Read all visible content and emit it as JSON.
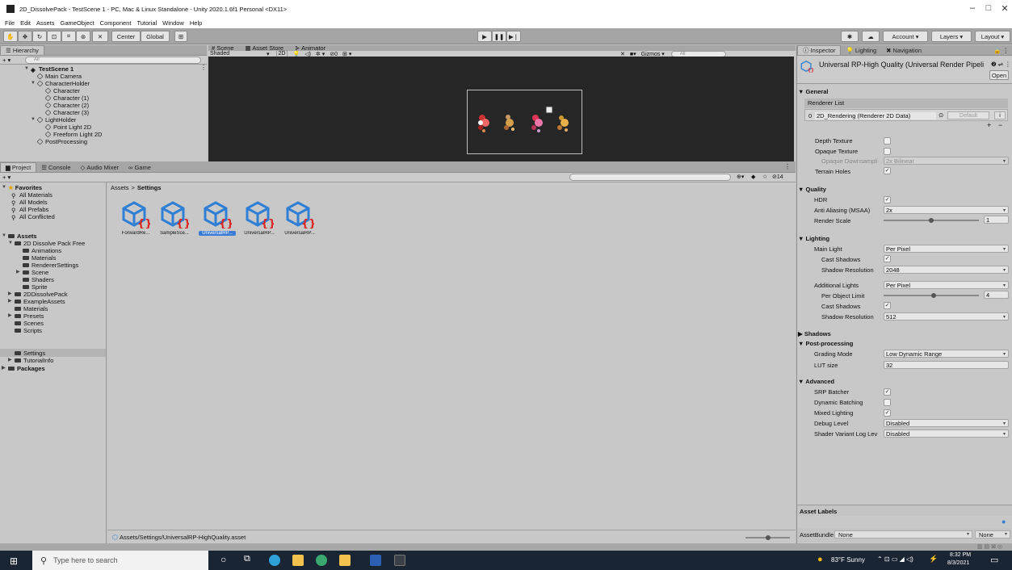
{
  "window": {
    "title": "2D_DissolvePack - TestScene 1 - PC, Mac & Linux Standalone - Unity 2020.1.6f1 Personal <DX11>",
    "controls": [
      "–",
      "□",
      "✕"
    ]
  },
  "menu": [
    "File",
    "Edit",
    "Assets",
    "GameObject",
    "Component",
    "Tutorial",
    "Window",
    "Help"
  ],
  "toolbar": {
    "pivot": "Center",
    "space": "Global",
    "account": "Account",
    "layers": "Layers",
    "layout": "Layout"
  },
  "hierarchy": {
    "tab": "Hierarchy",
    "search_placeholder": "All",
    "add": "+ ▾",
    "items": [
      {
        "label": "TestScene 1",
        "bold": true
      },
      {
        "label": "Main Camera"
      },
      {
        "label": "CharacterHolder"
      },
      {
        "label": "Character"
      },
      {
        "label": "Character (1)"
      },
      {
        "label": "Character (2)"
      },
      {
        "label": "Character (3)"
      },
      {
        "label": "LightHolder"
      },
      {
        "label": "Point Light 2D"
      },
      {
        "label": "Freeform Light 2D"
      },
      {
        "label": "PostProcessing"
      }
    ]
  },
  "scene": {
    "tabs": [
      "Scene",
      "Asset Store",
      "Animator"
    ],
    "shading": "Shaded",
    "mode_2d": "2D",
    "fx_count": "0",
    "gizmos": "Gizmos",
    "search_placeholder": "All"
  },
  "project": {
    "tabs": [
      "Project",
      "Console",
      "Audio Mixer",
      "Game"
    ],
    "add": "+ ▾",
    "hidden_count": "14",
    "breadcrumb": [
      "Assets",
      "Settings"
    ],
    "favorites_label": "Favorites",
    "favorites": [
      "All Materials",
      "All Models",
      "All Prefabs",
      "All Conflicted"
    ],
    "assets_label": "Assets",
    "tree": [
      {
        "label": "2D Dissolve Pack Free",
        "depth": 1
      },
      {
        "label": "Animations",
        "depth": 2
      },
      {
        "label": "Materials",
        "depth": 2
      },
      {
        "label": "RendererSettings",
        "depth": 2
      },
      {
        "label": "Scene",
        "depth": 2
      },
      {
        "label": "Shaders",
        "depth": 2
      },
      {
        "label": "Sprite",
        "depth": 2
      },
      {
        "label": "2DDissolvePack",
        "depth": 1
      },
      {
        "label": "ExampleAssets",
        "depth": 1
      },
      {
        "label": "Materials",
        "depth": 1
      },
      {
        "label": "Presets",
        "depth": 1
      },
      {
        "label": "Scenes",
        "depth": 1
      },
      {
        "label": "Scripts",
        "depth": 1
      },
      {
        "label": "Settings",
        "depth": 1
      },
      {
        "label": "TutorialInfo",
        "depth": 1
      }
    ],
    "packages_label": "Packages",
    "assets": [
      "ForwardRe...",
      "SampleSce...",
      "UniversalRP...",
      "UniversalRP...",
      "UniversalRP..."
    ],
    "status_path": "Assets/Settings/UniversalRP-HighQuality.asset"
  },
  "inspector": {
    "tabs": [
      "Inspector",
      "Lighting",
      "Navigation"
    ],
    "asset_title": "Universal RP-High Quality (Universal Render Pipeli",
    "open_button": "Open",
    "general": "General",
    "renderer_list": "Renderer List",
    "renderer_index": "0",
    "renderer_name": "2D_Rendering (Renderer 2D Data)",
    "default_button": "Default",
    "depth_texture": "Depth Texture",
    "opaque_texture": "Opaque Texture",
    "opaque_downsampling": "Opaque Downsampli",
    "opaque_downsampling_value": "2x Bilinear",
    "terrain_holes": "Terrain Holes",
    "quality": "Quality",
    "hdr": "HDR",
    "msaa": "Anti Aliasing (MSAA)",
    "msaa_value": "2x",
    "render_scale": "Render Scale",
    "render_scale_value": "1",
    "lighting": "Lighting",
    "main_light": "Main Light",
    "main_light_value": "Per Pixel",
    "cast_shadows": "Cast Shadows",
    "shadow_resolution": "Shadow Resolution",
    "main_shadow_res_value": "2048",
    "additional_lights": "Additional Lights",
    "additional_lights_value": "Per Pixel",
    "per_object_limit": "Per Object Limit",
    "per_object_limit_value": "4",
    "add_cast_shadows": "Cast Shadows",
    "add_shadow_resolution": "Shadow Resolution",
    "add_shadow_res_value": "512",
    "shadows": "Shadows",
    "post_processing": "Post-processing",
    "grading_mode": "Grading Mode",
    "grading_mode_value": "Low Dynamic Range",
    "lut_size": "LUT size",
    "lut_size_value": "32",
    "advanced": "Advanced",
    "srp_batcher": "SRP Batcher",
    "dynamic_batching": "Dynamic Batching",
    "mixed_lighting": "Mixed Lighting",
    "debug_level": "Debug Level",
    "debug_level_value": "Disabled",
    "shader_variant": "Shader Variant Log Lev",
    "shader_variant_value": "Disabled",
    "asset_labels": "Asset Labels",
    "asset_bundle": "AssetBundle",
    "asset_bundle_value": "None",
    "asset_bundle_variant": "None"
  },
  "taskbar": {
    "search_placeholder": "Type here to search",
    "weather": "83°F  Sunny",
    "time": "8:32 PM",
    "date": "8/3/2021"
  }
}
